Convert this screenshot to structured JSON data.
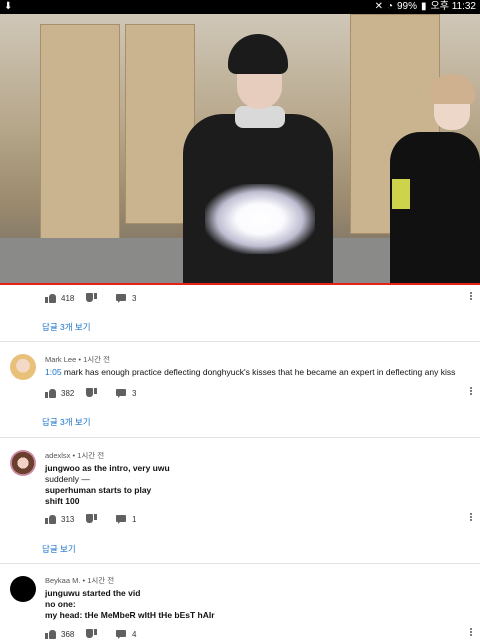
{
  "status_bar": {
    "battery": "99%",
    "time": "오후 11:32"
  },
  "comments": [
    {
      "likes": "418",
      "replies_count": "3",
      "view_replies": "답글 3개 보기"
    },
    {
      "author": "Mark Lee",
      "time": "1시간 전",
      "timestamp_link": "1:05",
      "text": "mark has enough practice deflecting donghyuck's kisses that he became an expert in deflecting any kiss",
      "likes": "382",
      "replies_count": "3",
      "view_replies": "답글 3개 보기"
    },
    {
      "author": "adexlsx",
      "time": "1시간 전",
      "lines": [
        "jungwoo as the intro, very uwu",
        "suddenly —",
        "superhuman starts to play",
        "shift 100"
      ],
      "likes": "313",
      "replies_count": "1",
      "view_replies": "답글 보기"
    },
    {
      "author": "Beykaa M.",
      "time": "1시간 전",
      "lines": [
        "junguwu started the vid",
        "no one:",
        "my head: tHe MeMbeR wItH tHe bEsT hAIr"
      ],
      "likes": "368",
      "replies_count": "4"
    }
  ],
  "colors": {
    "accent": "#1a73c9",
    "progress": "#e62117"
  }
}
